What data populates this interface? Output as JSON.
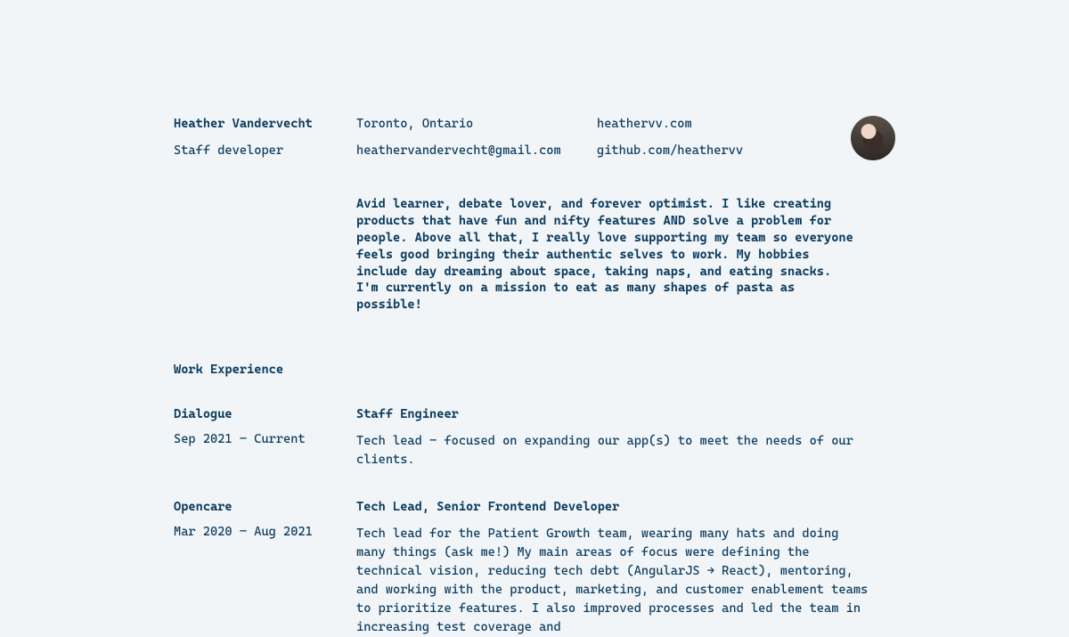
{
  "header": {
    "name": "Heather Vandervecht",
    "role": "Staff developer",
    "location": "Toronto, Ontario",
    "email": "heathervandervecht@gmail.com",
    "website": "heathervv.com",
    "github": "github.com/heathervv"
  },
  "bio": "Avid learner, debate lover, and forever optimist. I like creating products that have fun and nifty features AND solve a problem for people. Above all that, I really love supporting my team so everyone feels good bringing their authentic selves to work. My hobbies include day dreaming about space, taking naps, and eating snacks. I'm currently on a mission to eat as many shapes of pasta as possible!",
  "sections": {
    "work_experience_title": "Work Experience"
  },
  "jobs": [
    {
      "company": "Dialogue",
      "dates": "Sep 2021 – Current",
      "title": "Staff Engineer",
      "desc": "Tech lead – focused on expanding our app(s) to meet the needs of our clients."
    },
    {
      "company": "Opencare",
      "dates": "Mar 2020 – Aug 2021",
      "title": "Tech Lead, Senior Frontend Developer",
      "desc": "Tech lead for the Patient Growth team, wearing many hats and doing many things (ask me!) My main areas of focus were defining the technical vision, reducing tech debt (AngularJS → React), mentoring, and working with the product, marketing, and customer enablement teams to prioritize features. I also improved processes and led the team in increasing test coverage and"
    }
  ]
}
